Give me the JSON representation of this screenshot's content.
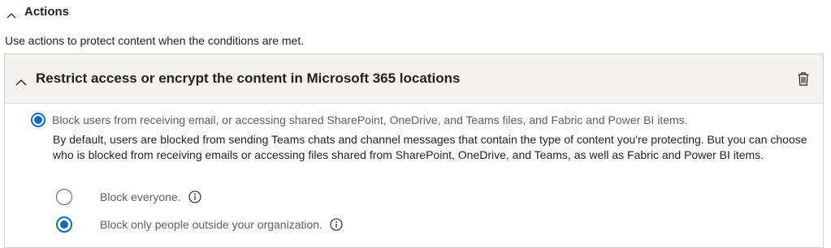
{
  "actions": {
    "title": "Actions",
    "description": "Use actions to protect content when the conditions are met."
  },
  "panel": {
    "title": "Restrict access or encrypt the content in Microsoft 365 locations",
    "delete_icon": "trash-icon",
    "chevron_icon": "chevron-up-icon",
    "main_option": {
      "label": "Block users from receiving email, or accessing shared SharePoint, OneDrive, and Teams files, and Fabric and Power BI items.",
      "checked": true,
      "description": "By default, users are blocked from sending Teams chats and channel messages that contain the type of content you're protecting. But you can choose who is blocked from receiving emails or accessing files shared from SharePoint, OneDrive, and Teams, as well as Fabric and Power BI items."
    },
    "sub_options": [
      {
        "label": "Block everyone.",
        "checked": false,
        "info_icon": "info-icon"
      },
      {
        "label": "Block only people outside your organization.",
        "checked": true,
        "info_icon": "info-icon"
      }
    ]
  },
  "colors": {
    "accent": "#0f6cbd",
    "header_bg": "#f3f2f1",
    "border": "#d2d0ce",
    "muted_text": "#605e5c"
  }
}
